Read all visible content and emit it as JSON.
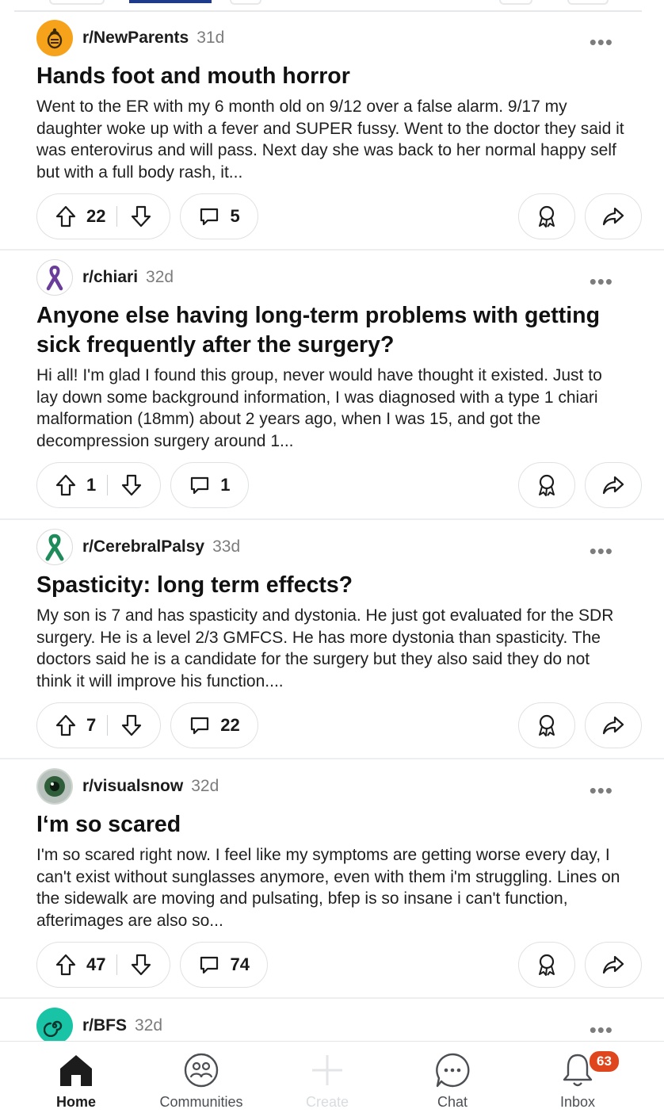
{
  "posts": [
    {
      "subreddit": "r/NewParents",
      "age": "31d",
      "title": "Hands foot and mouth horror",
      "body": "Went to the ER with my 6 month old on 9/12 over a false alarm. 9/17 my daughter woke up with a fever and SUPER fussy. Went to the doctor they said it was enterovirus and will pass. Next day she was back to her normal happy self but with a full body rash, it...",
      "votes": "22",
      "comments": "5",
      "avatar_color": "#f7a21b",
      "avatar_icon": "baby-bottle-icon"
    },
    {
      "subreddit": "r/chiari",
      "age": "32d",
      "title": "Anyone else having long-term problems with getting sick frequently after the surgery?",
      "body": "Hi all! I'm glad I found this group, never would have thought it existed. Just to lay down some background information, I was diagnosed with a type 1 chiari malformation (18mm) about 2 years ago, when I was 15, and got the decompression surgery around 1...",
      "votes": "1",
      "comments": "1",
      "avatar_color": "#6a3d9a",
      "avatar_icon": "awareness-ribbon-icon"
    },
    {
      "subreddit": "r/CerebralPalsy",
      "age": "33d",
      "title": "Spasticity: long term effects?",
      "body": "My son is 7 and has spasticity and dystonia. He just got evaluated for the SDR surgery. He is a level 2/3 GMFCS. He has more dystonia than spasticity. The doctors said he is a candidate for the surgery but they also said they do not think it will improve his function....",
      "votes": "7",
      "comments": "22",
      "avatar_color": "#1f8a5a",
      "avatar_icon": "awareness-ribbon-icon"
    },
    {
      "subreddit": "r/visualsnow",
      "age": "32d",
      "title": "I‘m so scared",
      "body": "I'm so scared right now. I feel like my symptoms are getting worse every day, I can't exist without sunglasses anymore, even with them i'm struggling. Lines on the sidewalk are moving and pulsating, bfep is so insane i can't function, afterimages are also so...",
      "votes": "47",
      "comments": "74",
      "avatar_color": "#2f5d3a",
      "avatar_icon": "eye-icon"
    },
    {
      "subreddit": "r/BFS",
      "age": "32d",
      "avatar_color": "#18c3a6",
      "avatar_icon": "spiral-icon"
    }
  ],
  "nav": {
    "home": "Home",
    "communities": "Communities",
    "create": "Create",
    "chat": "Chat",
    "inbox": "Inbox",
    "inbox_badge": "63"
  },
  "colors": {
    "accent_badge": "#e0461d",
    "active_tab": "#1e3a8a",
    "border": "#dfe1e3"
  }
}
